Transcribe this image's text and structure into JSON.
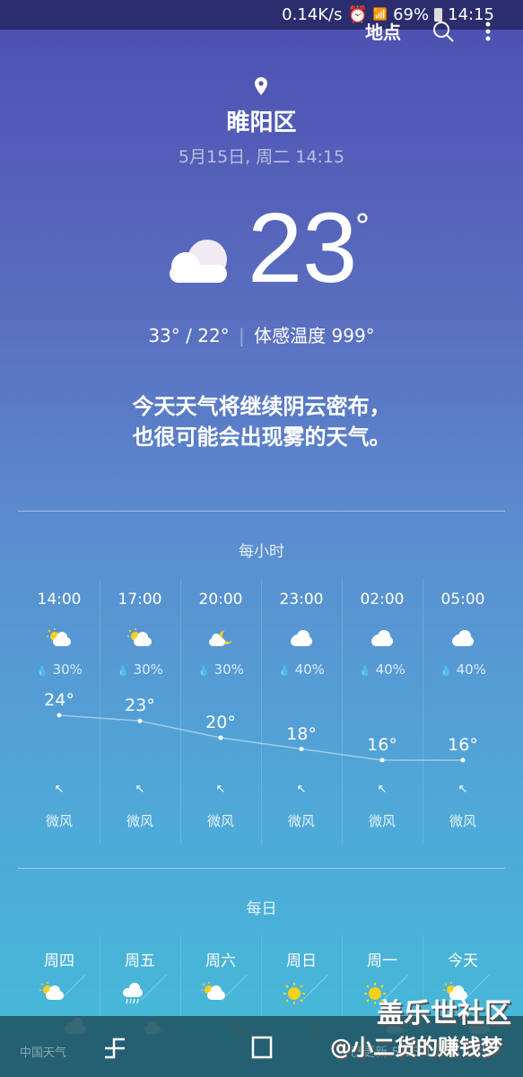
{
  "status_bar": {
    "speed": "0.14K/s",
    "battery": "69%",
    "time": "14:15"
  },
  "topbar": {
    "locations_label": "地点"
  },
  "location": {
    "name": "睢阳区",
    "datetime": "5月15日, 周二 14:15"
  },
  "current": {
    "temp": "23",
    "degree": "°",
    "high_low": "33° / 22°",
    "feels_like": "体感温度 999°",
    "icon": "cloud-icon"
  },
  "summary": [
    "今天天气将继续阴云密布，",
    "也很可能会出现雾的天气。"
  ],
  "hourly": {
    "title": "每小时",
    "items": [
      {
        "time": "14:00",
        "icon": "partly-sunny",
        "precip": "30%",
        "temp": 24,
        "temp_label": "24°",
        "wind": "微风"
      },
      {
        "time": "17:00",
        "icon": "partly-sunny",
        "precip": "30%",
        "temp": 23,
        "temp_label": "23°",
        "wind": "微风"
      },
      {
        "time": "20:00",
        "icon": "partly-moon",
        "precip": "30%",
        "temp": 20,
        "temp_label": "20°",
        "wind": "微风"
      },
      {
        "time": "23:00",
        "icon": "cloud",
        "precip": "40%",
        "temp": 18,
        "temp_label": "18°",
        "wind": "微风"
      },
      {
        "time": "02:00",
        "icon": "cloud",
        "precip": "40%",
        "temp": 16,
        "temp_label": "16°",
        "wind": "微风"
      },
      {
        "time": "05:00",
        "icon": "cloud",
        "precip": "40%",
        "temp": 16,
        "temp_label": "16°",
        "wind": "微风"
      }
    ]
  },
  "daily": {
    "title": "每日",
    "items": [
      {
        "day": "周四",
        "day_icon": "partly-sunny",
        "night_icon": "cloud"
      },
      {
        "day": "周五",
        "day_icon": "rain",
        "night_icon": "partly-moon"
      },
      {
        "day": "周六",
        "day_icon": "partly-sunny",
        "night_icon": "moon"
      },
      {
        "day": "周日",
        "day_icon": "sun",
        "night_icon": "moon"
      },
      {
        "day": "周一",
        "day_icon": "sun",
        "night_icon": "partly-moon"
      },
      {
        "day": "今天",
        "day_icon": "partly-sunny",
        "night_icon": "cloud"
      }
    ]
  },
  "footer": {
    "provider": "中国天气",
    "updated": "已更新 5/15 14:15"
  },
  "watermark": {
    "line1": "盖乐世社区",
    "line2": "@小二货的赚钱梦"
  }
}
